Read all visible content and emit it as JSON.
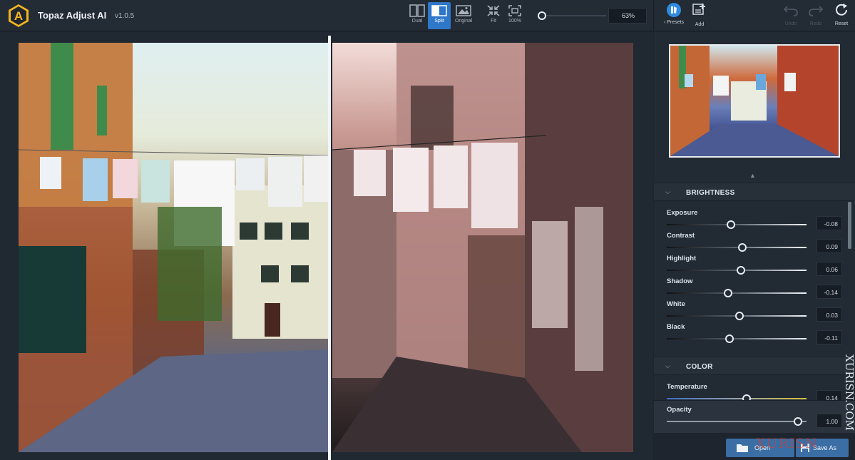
{
  "app": {
    "title": "Topaz Adjust AI",
    "version": "v1.0.5",
    "logo_letter": "A"
  },
  "toolbar": {
    "view_modes": [
      {
        "label": "Dual",
        "icon": "dual-view-icon",
        "active": false
      },
      {
        "label": "Split",
        "icon": "split-view-icon",
        "active": true
      },
      {
        "label": "Original",
        "icon": "original-view-icon",
        "active": false
      }
    ],
    "fit_label": "Fit",
    "zoom100_label": "100%",
    "zoom_value": "63%",
    "zoom_level": 0.0,
    "presets_label": "Presets",
    "add_label": "Add",
    "undo_label": "Undo",
    "redo_label": "Redo",
    "reset_label": "Reset"
  },
  "panel": {
    "sections": [
      {
        "title": "BRIGHTNESS",
        "sliders": [
          {
            "label": "Exposure",
            "value": "-0.08",
            "pos": 0.46
          },
          {
            "label": "Contrast",
            "value": "0.09",
            "pos": 0.54
          },
          {
            "label": "Highlight",
            "value": "0.06",
            "pos": 0.53
          },
          {
            "label": "Shadow",
            "value": "-0.14",
            "pos": 0.44
          },
          {
            "label": "White",
            "value": "0.03",
            "pos": 0.52
          },
          {
            "label": "Black",
            "value": "-0.11",
            "pos": 0.45
          }
        ]
      },
      {
        "title": "COLOR",
        "sliders": [
          {
            "label": "Temperature",
            "value": "0.14",
            "pos": 0.57
          }
        ]
      }
    ],
    "opacity": {
      "label": "Opacity",
      "value": "1.00",
      "pos": 1.0
    },
    "open_label": "Open",
    "save_as_label": "Save As"
  },
  "watermark": {
    "vertical": "XURISN.COM",
    "horizontal": "XURISN"
  },
  "colors": {
    "accent": "#2e77c9",
    "panel": "#222a34",
    "button": "#3a6ea5"
  }
}
